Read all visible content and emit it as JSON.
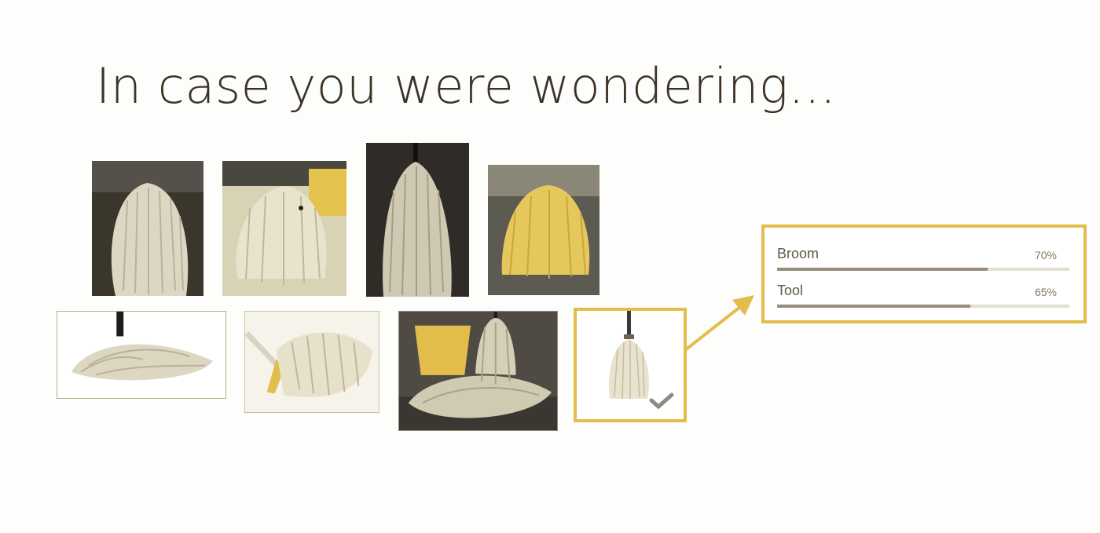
{
  "title": "In case you were wondering...",
  "images": [
    {
      "subject": "komondor dog, white corded coat, dark background"
    },
    {
      "subject": "komondor dog walking on yellow floor"
    },
    {
      "subject": "mop head hanging on pole, dark room"
    },
    {
      "subject": "komondor dog with yellow tint in office"
    },
    {
      "subject": "mop head with black handle on white background"
    },
    {
      "subject": "flat mop with yellow handle"
    },
    {
      "subject": "mop with yellow bucket"
    },
    {
      "subject": "mop hanging, selected",
      "selected": true
    }
  ],
  "classification": {
    "results": [
      {
        "label": "Broom",
        "percent_text": "70%",
        "value": 0.72
      },
      {
        "label": "Tool",
        "percent_text": "65%",
        "value": 0.66
      }
    ]
  },
  "colors": {
    "accent": "#e2bd4c",
    "text": "#3c3226",
    "check": "#8f8a80"
  }
}
